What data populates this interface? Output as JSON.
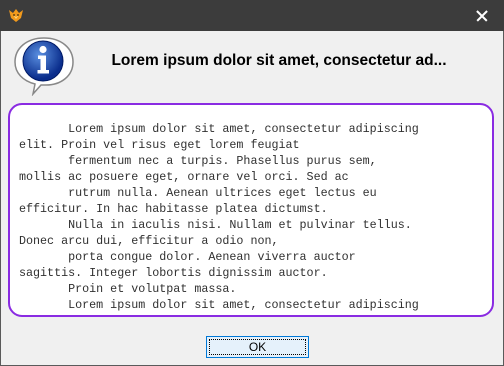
{
  "window": {
    "app_icon": "fox-logo-icon",
    "close_icon": "close-icon"
  },
  "dialog": {
    "icon": "info-speech-bubble-icon",
    "heading": "Lorem ipsum dolor sit amet, consectetur ad...",
    "message_lines": [
      "       Lorem ipsum dolor sit amet, consectetur adipiscing",
      "elit. Proin vel risus eget lorem feugiat",
      "       fermentum nec a turpis. Phasellus purus sem,",
      "mollis ac posuere eget, ornare vel orci. Sed ac",
      "       rutrum nulla. Aenean ultrices eget lectus eu",
      "efficitur. In hac habitasse platea dictumst.",
      "       Nulla in iaculis nisi. Nullam et pulvinar tellus.",
      "Donec arcu dui, efficitur a odio non,",
      "       porta congue dolor. Aenean viverra auctor",
      "sagittis. Integer lobortis dignissim auctor.",
      "       Proin et volutpat massa.",
      "       Lorem ipsum dolor sit amet, consectetur adipiscing"
    ],
    "ok_label": "OK"
  },
  "colors": {
    "titlebar": "#3c3c3c",
    "message_border": "#8a2be2",
    "button_border": "#0078d7"
  }
}
